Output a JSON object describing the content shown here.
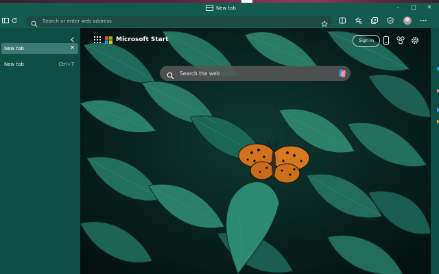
{
  "window": {
    "title": "New tab"
  },
  "toolbar": {
    "address_placeholder": "Search or enter web address"
  },
  "sidebar": {
    "active_tab": {
      "label": "New tab"
    },
    "new_tab": {
      "label": "New tab",
      "shortcut": "Ctrl+T"
    }
  },
  "start": {
    "brand": "Microsoft Start",
    "sign_in": "Sign in",
    "search_placeholder": "Search the web"
  },
  "icons": [
    "tab-icon",
    "minimize-icon",
    "maximize-icon",
    "close-icon",
    "sidebar-icon",
    "refresh-icon",
    "search-icon",
    "favorite-star-icon",
    "split-screen-icon",
    "favorites-icon",
    "collections-icon",
    "browser-essentials-icon",
    "profile-avatar",
    "more-icon",
    "collapse-icon",
    "close-tab-icon",
    "apps-icon",
    "microsoft-logo",
    "phone-icon",
    "rewards-icon",
    "settings-icon",
    "copilot-icon"
  ],
  "colors": {
    "frame": "#145a4f",
    "panel": "#0f4e44",
    "active_tab": "#3f7a72",
    "search_box": "#555555"
  }
}
